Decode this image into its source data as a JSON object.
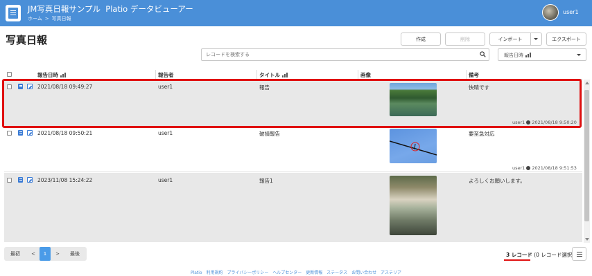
{
  "app": {
    "title": "JM写真日報サンプル",
    "subtitle": "Platio データビューアー",
    "breadcrumb": [
      "ホーム",
      "写真日報"
    ],
    "breadcrumb_sep": ">",
    "user": "user1",
    "accent_color": "#4a8fd8"
  },
  "page": {
    "title": "写真日報"
  },
  "toolbar": {
    "create_label": "作成",
    "delete_label": "削除",
    "import_label": "インポート",
    "export_label": "エクスポート"
  },
  "search": {
    "placeholder": "レコードを検索する",
    "icon": "search-icon"
  },
  "sort": {
    "selected": "報告日時"
  },
  "table": {
    "columns": [
      "報告日時",
      "報告者",
      "タイトル",
      "画像",
      "備考"
    ],
    "rows": [
      {
        "datetime": "2021/08/18 09:49:27",
        "reporter": "user1",
        "title": "報告",
        "image": "river-landscape-photo",
        "note": "快晴です",
        "meta_user": "user1",
        "meta_time": "2021/08/18 9:50:20",
        "highlighted": true
      },
      {
        "datetime": "2021/08/18 09:50:21",
        "reporter": "user1",
        "title": "破損報告",
        "image": "power-line-photo",
        "note": "要至急対応",
        "meta_user": "user1",
        "meta_time": "2021/08/18 9:51:53",
        "highlighted": false
      },
      {
        "datetime": "2023/11/08 15:24:22",
        "reporter": "user1",
        "title": "報告1",
        "image": "store-counter-photo",
        "note": "よろしくお願いします。",
        "meta_user": "",
        "meta_time": "",
        "highlighted": false
      }
    ]
  },
  "pagination": {
    "first": "最初",
    "prev": "<",
    "current": "1",
    "next": ">",
    "last": "最後"
  },
  "record_count": {
    "count": "3 レコード",
    "selected": "(0 レコード選択)"
  },
  "footer": {
    "links": [
      "Platio",
      "利用規約",
      "プライバシーポリシー",
      "ヘルプセンター",
      "更新情報",
      "ステータス",
      "お問い合わせ",
      "アステリア"
    ]
  },
  "colors": {
    "highlight_border": "#e01010",
    "active_page": "#4a9be8",
    "row_gray": "#e8e8e8"
  }
}
